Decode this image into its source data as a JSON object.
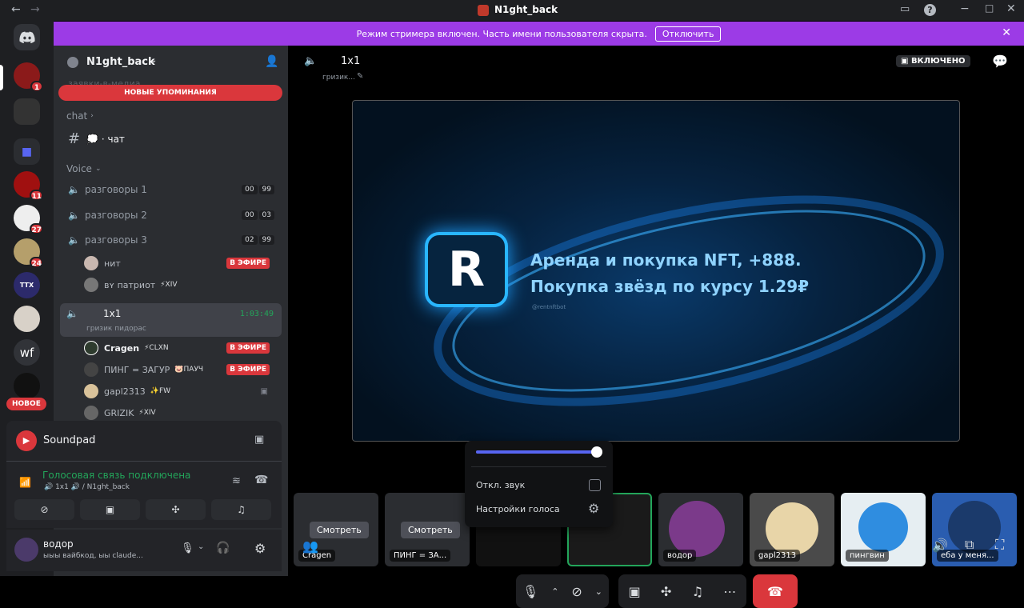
{
  "titlebar": {
    "title": "N1ght_back"
  },
  "streamer": {
    "text": "Режим стримера включен. Часть имени пользователя скрыта.",
    "button": "Отключить"
  },
  "guilds": [
    {
      "badge": "1"
    },
    {
      "badge": ""
    },
    {
      "badge": ""
    },
    {
      "badge": "11"
    },
    {
      "badge": "27"
    },
    {
      "badge": "24"
    },
    {
      "label": "TTX",
      "badge": ""
    },
    {
      "badge": ""
    },
    {
      "label": "wf",
      "badge": ""
    },
    {
      "badge": ""
    }
  ],
  "guild_new": "НОВОЕ",
  "server": {
    "name": "N1ght_back",
    "new_mentions": "НОВЫЕ УПОМИНАНИЯ",
    "hidden_channel": "заявки-в-медиа"
  },
  "categories": {
    "chat": "chat",
    "voice": "Voice"
  },
  "text_channels": [
    {
      "name": "💭 · чат"
    }
  ],
  "voice_channels": [
    {
      "name": "разговоры 1",
      "count_a": "00",
      "count_b": "99"
    },
    {
      "name": "разговоры 2",
      "count_a": "00",
      "count_b": "03"
    },
    {
      "name": "разговоры 3",
      "count_a": "02",
      "count_b": "99"
    }
  ],
  "vc3_users": [
    {
      "name": "нит",
      "tag": "",
      "live": "В ЭФИРЕ"
    },
    {
      "name": "ʙʏ патриот",
      "tag": "⚡XIV",
      "live": ""
    }
  ],
  "current_vc": {
    "name": "1x1",
    "time": "1:03:49",
    "status": "гризик пидорас"
  },
  "current_users": [
    {
      "name": "Cragen",
      "tag": "⚡CLXN",
      "live": "В ЭФИРЕ"
    },
    {
      "name": "ПИНГ = ЗАГУР",
      "tag": "🐷ПАУЧ",
      "live": "В ЭФИРЕ"
    },
    {
      "name": "gapl2313",
      "tag": "✨FW",
      "live": ""
    },
    {
      "name": "GRIZIK",
      "tag": "⚡XIV",
      "live": ""
    }
  ],
  "soundpad": {
    "name": "Soundpad"
  },
  "voice_status": {
    "title": "Голосовая связь подключена",
    "sub": "🔊 1x1 🔊 / N1ght_back"
  },
  "user_panel": {
    "name": "водор",
    "status": "ыыы вайбкод, ыы claude..."
  },
  "stage": {
    "channel": "1x1",
    "status": "гризик...",
    "live_label": "ВКЛЮЧЕНО",
    "stream_line1": "Аренда и покупка NFT, +888.",
    "stream_line2": "Покупка звёзд по курсу 1.29₽",
    "stream_handle": "@rentnftbot"
  },
  "popup": {
    "mute": "Откл. звук",
    "settings": "Настройки голоса",
    "volume": 0.96
  },
  "tiles": [
    {
      "label": "Cragen",
      "watch": "Смотреть"
    },
    {
      "label": "ПИНГ = ЗА...",
      "watch": "Смотреть"
    },
    {
      "label": ""
    },
    {
      "label": "водор"
    },
    {
      "label": "gapl2313"
    },
    {
      "label": "пингвин"
    },
    {
      "label": "еба у меня..."
    }
  ],
  "colors": {
    "accent": "#5865f2",
    "danger": "#da373c",
    "green": "#23a55a",
    "streamer": "#9c3be6"
  }
}
